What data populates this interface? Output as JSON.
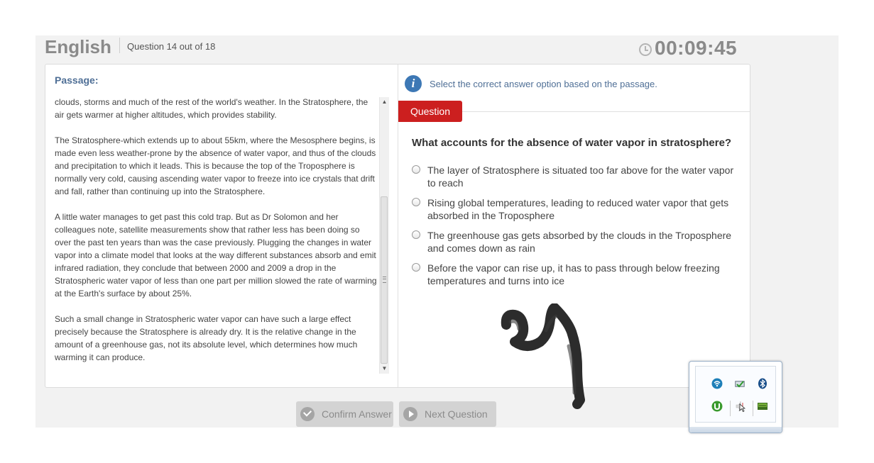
{
  "header": {
    "subject": "English",
    "question_counter": "Question 14 out of 18",
    "timer": "00:09:45"
  },
  "passage": {
    "label": "Passage:",
    "paragraphs": [
      "clouds, storms and much of the rest of the world's weather. In the Stratosphere, the air gets warmer at higher altitudes, which provides stability.",
      "The Stratosphere-which extends up to about 55km, where the Mesosphere begins, is made even less weather-prone by the absence of water vapor, and thus of the clouds and precipitation to which it leads. This is because the top of the Troposphere is normally very cold, causing ascending water vapor to freeze into ice crystals that drift and fall, rather than continuing up into the Stratosphere.",
      "A little water manages to get past this cold trap. But as Dr Solomon and her colleagues note, satellite measurements show that rather less has been doing so over the past ten years than was the case previously. Plugging the changes in water vapor into a climate model that looks at the way different substances absorb and emit infrared radiation, they conclude that between 2000 and 2009 a drop in the Stratospheric water vapor of less than one part per million slowed the rate of warming at the Earth's surface by about 25%.",
      "Such a small change in Stratospheric water vapor can have such a large effect precisely because the Stratosphere is already dry. It is the relative change in the amount of a greenhouse gas, not its absolute level, which determines how much warming it can produce."
    ]
  },
  "instruction": "Select the correct answer option based on the passage.",
  "question_tab": "Question",
  "question": {
    "text": "What accounts for the absence of water vapor in stratosphere?",
    "options": [
      "The layer of Stratosphere is situated too far above for the water vapor to reach",
      "Rising global temperatures, leading to reduced water vapor that gets absorbed in the Troposphere",
      "The greenhouse gas gets absorbed by the clouds in the Troposphere and comes down as rain",
      "Before the vapor can rise up, it has to pass through below freezing temperatures and turns into ice"
    ]
  },
  "buttons": {
    "confirm": "Confirm Answer",
    "next": "Next Question"
  },
  "tray_icons": [
    "wifi-icon",
    "network-check-icon",
    "bluetooth-icon",
    "utorrent-icon",
    "volume-icon",
    "drive-icon"
  ],
  "colors": {
    "accent_blue": "#4f6f96",
    "question_tab_red": "#cc1f1f",
    "info_icon_blue": "#3d78b5",
    "button_disabled": "#d3d3d3"
  }
}
